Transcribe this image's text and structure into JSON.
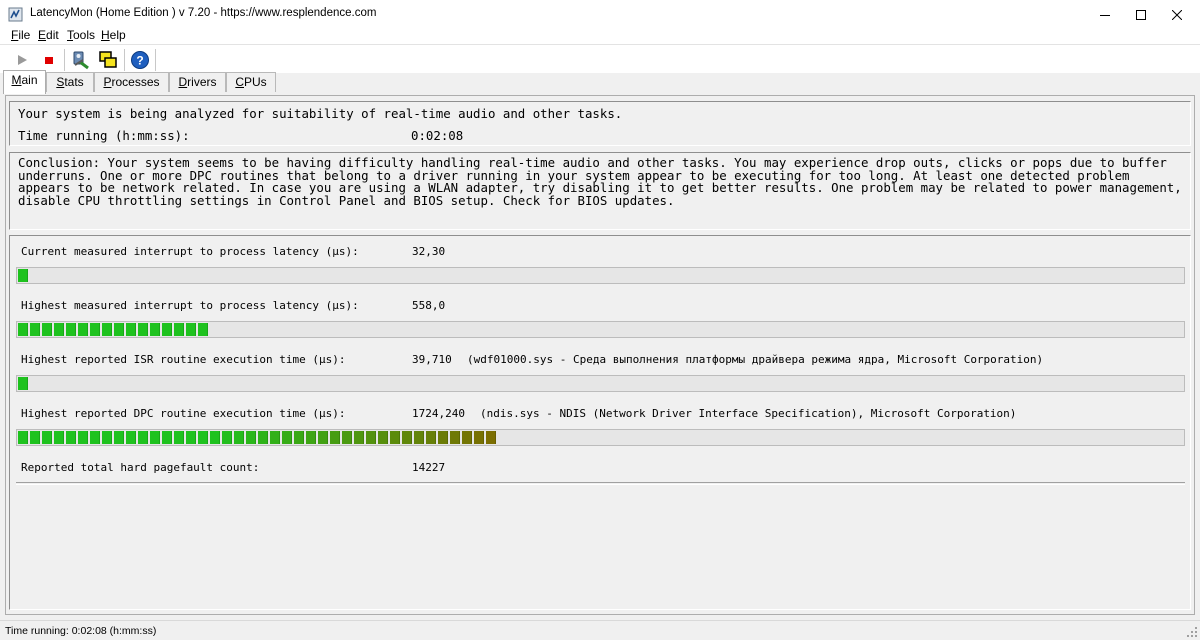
{
  "window": {
    "title": "LatencyMon  (Home Edition )  v 7.20 - https://www.resplendence.com"
  },
  "menu": {
    "items": [
      {
        "accel": "F",
        "rest": "ile"
      },
      {
        "accel": "E",
        "rest": "dit"
      },
      {
        "accel": "T",
        "rest": "ools"
      },
      {
        "accel": "H",
        "rest": "elp"
      }
    ]
  },
  "toolbar": {
    "icons": [
      "play-icon",
      "stop-icon",
      "driver-icon",
      "windows-icon",
      "help-icon"
    ]
  },
  "tabs": [
    {
      "accel": "M",
      "rest": "ain",
      "active": true
    },
    {
      "accel": "S",
      "rest": "tats",
      "active": false
    },
    {
      "accel": "P",
      "rest": "rocesses",
      "active": false
    },
    {
      "accel": "D",
      "rest": "rivers",
      "active": false
    },
    {
      "accel": "C",
      "rest": "PUs",
      "active": false
    }
  ],
  "main": {
    "status_line": "Your system is being analyzed for suitability of real-time audio and other tasks.",
    "time_label": "Time running (h:mm:ss):",
    "time_value": "0:02:08",
    "conclusion": "Conclusion: Your system seems to be having difficulty handling real-time audio and other tasks. You may experience drop outs, clicks or pops due to buffer underruns. One or more DPC routines that belong to a driver running in your system appear to be executing for too long. At least one detected problem appears to be network related. In case you are using a WLAN adapter, try disabling it to get better results. One problem may be related to power management, disable CPU throttling settings in Control Panel and BIOS setup. Check for BIOS updates.",
    "metrics": {
      "current": {
        "label": "Current measured interrupt to process latency (µs):",
        "value": "32,30",
        "segments": 1
      },
      "highest": {
        "label": "Highest measured interrupt to process latency (µs):",
        "value": "558,0",
        "segments": 16
      },
      "isr": {
        "label": "Highest reported ISR routine execution time (µs):",
        "value": "39,710",
        "driver": "(wdf01000.sys - Среда выполнения платформы драйвера режима ядра, Microsoft Corporation)",
        "segments": 1
      },
      "dpc": {
        "label": "Highest reported DPC routine execution time (µs):",
        "value": "1724,240",
        "driver": "(ndis.sys - NDIS (Network Driver Interface Specification), Microsoft Corporation)",
        "segments": 40
      },
      "pagefault": {
        "label": "Reported total hard pagefault count:",
        "value": "14227"
      }
    }
  },
  "statusbar": {
    "text": "Time running: 0:02:08  (h:mm:ss)"
  },
  "colors": {
    "meter_green": "#1ec21e",
    "meter_olive": "#7f6a00",
    "stop_red": "#e00000"
  }
}
